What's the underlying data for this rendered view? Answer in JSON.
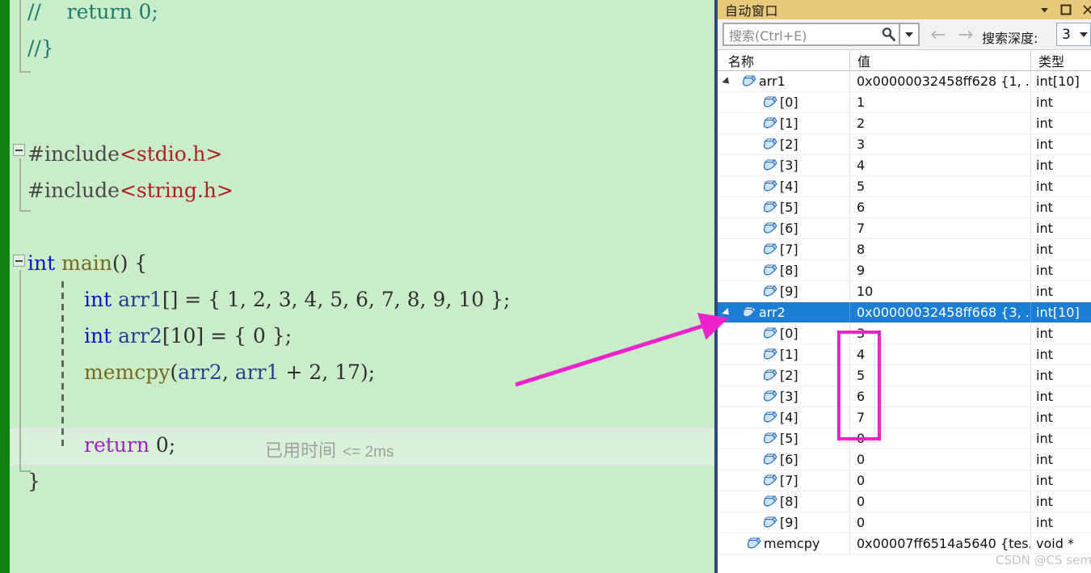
{
  "editor": {
    "language": "c",
    "background_color": "#c9edc9",
    "lines": [
      {
        "indent": 0,
        "tokens": [
          {
            "t": "//    return 0;",
            "c": "cmt"
          }
        ]
      },
      {
        "indent": 0,
        "tokens": [
          {
            "t": "//}",
            "c": "cmt"
          }
        ]
      },
      {
        "indent": 0,
        "tokens": []
      },
      {
        "indent": 0,
        "tokens": []
      },
      {
        "indent": 0,
        "tokens": [
          {
            "t": "#include",
            "c": "pp"
          },
          {
            "t": "<stdio.h>",
            "c": "str"
          }
        ]
      },
      {
        "indent": 0,
        "tokens": [
          {
            "t": "#include",
            "c": "pp"
          },
          {
            "t": "<string.h>",
            "c": "str"
          }
        ]
      },
      {
        "indent": 0,
        "tokens": []
      },
      {
        "indent": 0,
        "tokens": [
          {
            "t": "int",
            "c": "kw"
          },
          {
            "t": " ",
            "c": "punct"
          },
          {
            "t": "main",
            "c": "fn"
          },
          {
            "t": "() {",
            "c": "punct"
          }
        ]
      },
      {
        "indent": 1,
        "tokens": [
          {
            "t": "int",
            "c": "kw"
          },
          {
            "t": " ",
            "c": "punct"
          },
          {
            "t": "arr1",
            "c": "ident"
          },
          {
            "t": "[] = { 1, 2, 3, 4, 5, 6, 7, 8, 9, 10 };",
            "c": "punct"
          }
        ]
      },
      {
        "indent": 1,
        "tokens": [
          {
            "t": "int",
            "c": "kw"
          },
          {
            "t": " ",
            "c": "punct"
          },
          {
            "t": "arr2",
            "c": "ident"
          },
          {
            "t": "[10] = { 0 };",
            "c": "punct"
          }
        ]
      },
      {
        "indent": 1,
        "tokens": [
          {
            "t": "memcpy",
            "c": "fn"
          },
          {
            "t": "(",
            "c": "punct"
          },
          {
            "t": "arr2",
            "c": "ident"
          },
          {
            "t": ", ",
            "c": "punct"
          },
          {
            "t": "arr1",
            "c": "ident"
          },
          {
            "t": " + 2, 17);",
            "c": "punct"
          }
        ]
      },
      {
        "indent": 1,
        "tokens": []
      },
      {
        "indent": 1,
        "tokens": [
          {
            "t": "return",
            "c": "ret"
          },
          {
            "t": " 0;",
            "c": "punct"
          }
        ]
      },
      {
        "indent": 0,
        "tokens": [
          {
            "t": "}",
            "c": "punct"
          }
        ]
      }
    ],
    "elapsed_time_label": "已用时间",
    "elapsed_time_value": "<= 2ms"
  },
  "autos": {
    "title": "自动窗口",
    "titlebar_color": "#e8c87a",
    "window_buttons": [
      {
        "name": "dropdown",
        "glyph": "▼"
      },
      {
        "name": "maximize",
        "glyph": "❐"
      },
      {
        "name": "close",
        "glyph": "✕"
      }
    ],
    "search": {
      "placeholder": "搜索(Ctrl+E)",
      "value": ""
    },
    "nav": {
      "back": "←",
      "forward": "→"
    },
    "depth": {
      "label": "搜索深度:",
      "value": "3"
    },
    "columns": [
      "名称",
      "值",
      "类型"
    ],
    "rows": [
      {
        "indent": 0,
        "expander": "expanded",
        "icon": "variable-icon",
        "name": "arr1",
        "value": "0x00000032458ff628 {1, ...",
        "type": "int[10]",
        "selected": false
      },
      {
        "indent": 1,
        "expander": "none",
        "icon": "variable-icon",
        "name": "[0]",
        "value": "1",
        "type": "int",
        "selected": false
      },
      {
        "indent": 1,
        "expander": "none",
        "icon": "variable-icon",
        "name": "[1]",
        "value": "2",
        "type": "int",
        "selected": false
      },
      {
        "indent": 1,
        "expander": "none",
        "icon": "variable-icon",
        "name": "[2]",
        "value": "3",
        "type": "int",
        "selected": false
      },
      {
        "indent": 1,
        "expander": "none",
        "icon": "variable-icon",
        "name": "[3]",
        "value": "4",
        "type": "int",
        "selected": false
      },
      {
        "indent": 1,
        "expander": "none",
        "icon": "variable-icon",
        "name": "[4]",
        "value": "5",
        "type": "int",
        "selected": false
      },
      {
        "indent": 1,
        "expander": "none",
        "icon": "variable-icon",
        "name": "[5]",
        "value": "6",
        "type": "int",
        "selected": false
      },
      {
        "indent": 1,
        "expander": "none",
        "icon": "variable-icon",
        "name": "[6]",
        "value": "7",
        "type": "int",
        "selected": false
      },
      {
        "indent": 1,
        "expander": "none",
        "icon": "variable-icon",
        "name": "[7]",
        "value": "8",
        "type": "int",
        "selected": false
      },
      {
        "indent": 1,
        "expander": "none",
        "icon": "variable-icon",
        "name": "[8]",
        "value": "9",
        "type": "int",
        "selected": false
      },
      {
        "indent": 1,
        "expander": "none",
        "icon": "variable-icon",
        "name": "[9]",
        "value": "10",
        "type": "int",
        "selected": false
      },
      {
        "indent": 0,
        "expander": "expanded",
        "icon": "variable-icon",
        "name": "arr2",
        "value": "0x00000032458ff668 {3, ...",
        "type": "int[10]",
        "selected": true
      },
      {
        "indent": 1,
        "expander": "none",
        "icon": "variable-icon",
        "name": "[0]",
        "value": "3",
        "type": "int",
        "selected": false
      },
      {
        "indent": 1,
        "expander": "none",
        "icon": "variable-icon",
        "name": "[1]",
        "value": "4",
        "type": "int",
        "selected": false
      },
      {
        "indent": 1,
        "expander": "none",
        "icon": "variable-icon",
        "name": "[2]",
        "value": "5",
        "type": "int",
        "selected": false
      },
      {
        "indent": 1,
        "expander": "none",
        "icon": "variable-icon",
        "name": "[3]",
        "value": "6",
        "type": "int",
        "selected": false
      },
      {
        "indent": 1,
        "expander": "none",
        "icon": "variable-icon",
        "name": "[4]",
        "value": "7",
        "type": "int",
        "selected": false
      },
      {
        "indent": 1,
        "expander": "none",
        "icon": "variable-icon",
        "name": "[5]",
        "value": "0",
        "type": "int",
        "selected": false
      },
      {
        "indent": 1,
        "expander": "none",
        "icon": "variable-icon",
        "name": "[6]",
        "value": "0",
        "type": "int",
        "selected": false
      },
      {
        "indent": 1,
        "expander": "none",
        "icon": "variable-icon",
        "name": "[7]",
        "value": "0",
        "type": "int",
        "selected": false
      },
      {
        "indent": 1,
        "expander": "none",
        "icon": "variable-icon",
        "name": "[8]",
        "value": "0",
        "type": "int",
        "selected": false
      },
      {
        "indent": 1,
        "expander": "none",
        "icon": "variable-icon",
        "name": "[9]",
        "value": "0",
        "type": "int",
        "selected": false
      },
      {
        "indent": 0,
        "expander": "none",
        "icon": "variable-icon",
        "name": "memcpy",
        "value": "0x00007ff6514a5640 {tes...",
        "type": "void *",
        "selected": false
      }
    ]
  },
  "annotations": {
    "arrow_color": "#ee22cc",
    "highlight_rect_color": "#ee22cc",
    "watermark": "CSDN @CS semi"
  }
}
